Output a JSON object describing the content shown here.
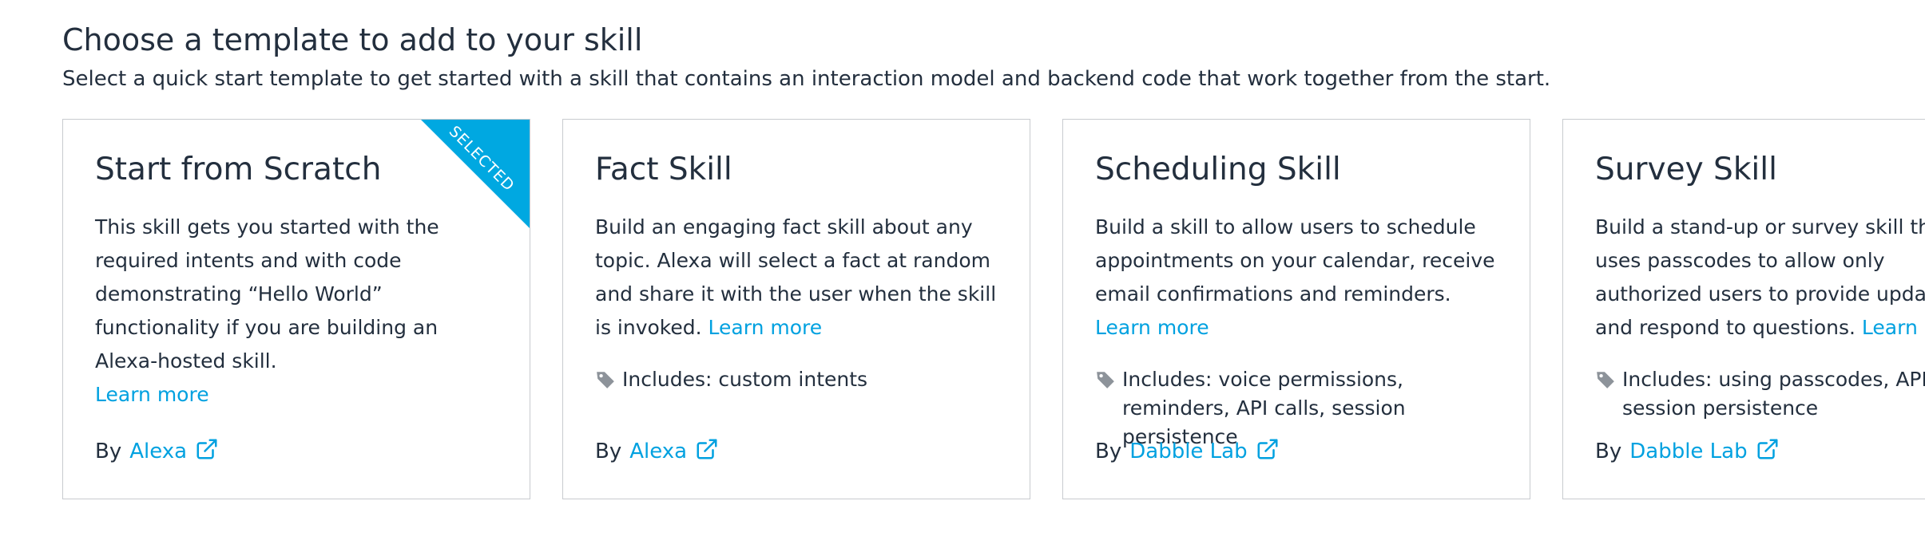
{
  "header": {
    "title": "Choose a template to add to your skill",
    "subtitle": "Select a quick start template to get started with a skill that contains an interaction model and backend code that work together from the start."
  },
  "by_label": "By",
  "learn_more_label": "Learn more",
  "selected_badge": "SELECTED",
  "colors": {
    "link": "#00a1e0",
    "ribbon": "#00a8e1",
    "text": "#232f3e",
    "border": "#c8cbcf"
  },
  "cards": [
    {
      "title": "Start from Scratch",
      "description": "This skill gets you started with the required intents and with code demonstrating “Hello World” functionality if you are building an Alexa-hosted skill.",
      "includes": "",
      "author": "Alexa",
      "selected": true
    },
    {
      "title": "Fact Skill",
      "description": "Build an engaging fact skill about any topic. Alexa will select a fact at random and share it with the user when the skill is invoked.",
      "includes": "Includes: custom intents",
      "author": "Alexa",
      "selected": false
    },
    {
      "title": "Scheduling Skill",
      "description": "Build a skill to allow users to schedule appointments on your calendar, receive email confirmations and reminders.",
      "includes": "Includes: voice permissions, reminders, API calls, session persistence",
      "author": "Dabble Lab",
      "selected": false
    },
    {
      "title": "Survey Skill",
      "description": "Build a stand-up or survey skill that uses passcodes to allow only authorized users to provide updates and respond to questions.",
      "includes": "Includes: using passcodes, API calls, session persistence",
      "author": "Dabble Lab",
      "selected": false
    }
  ]
}
